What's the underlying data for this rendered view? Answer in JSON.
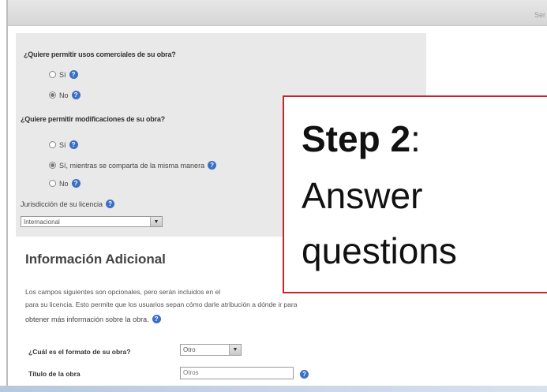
{
  "topbar": {
    "corner_text": "Ser"
  },
  "form": {
    "q1": "¿Quiere permitir usos comerciales de su obra?",
    "q1_options": [
      "Sí",
      "No"
    ],
    "q2": "¿Quiere permitir modificaciones de su obra?",
    "q2_options": [
      "Sí",
      "Sí, mientras se comparta de la misma manera",
      "No"
    ],
    "jurisdiction_label": "Jurisdicción de su licencia",
    "jurisdiction_value": "Internacional"
  },
  "additional": {
    "heading": "Información Adicional",
    "para_line1": "Los campos siguientes son opcionales, pero serán incluidos en el",
    "para_line2": "para su licencia. Esto permite que los usuarios sepan cómo darle atribución a dónde ir para",
    "para_line3": "obtener más información sobre la obra.",
    "format_label": "¿Cuál es el formato de su obra?",
    "format_value": "Otro",
    "title_label": "Título de la obra",
    "title_value": "Otros"
  },
  "callout": {
    "step": "Step 2",
    "colon": ":",
    "line2": "Answer",
    "line3": "questions"
  }
}
